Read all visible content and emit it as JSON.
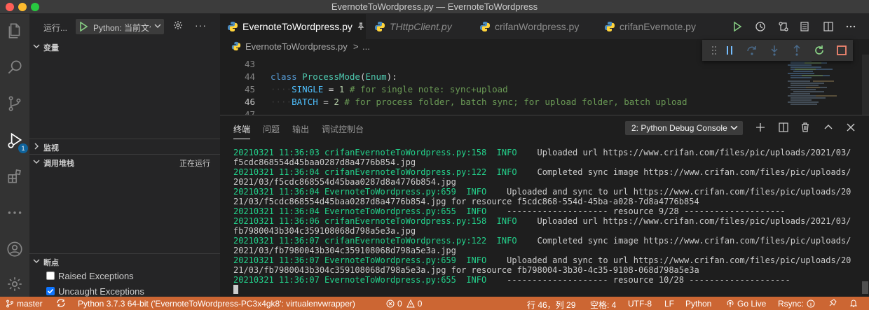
{
  "window": {
    "title": "EvernoteToWordpress.py — EvernoteToWordpress"
  },
  "colors": {
    "statusbar": "#cc6633",
    "accent": "#0e639c",
    "terminal_green": "#23d18b",
    "close": "#ff5f57",
    "minimize": "#febc2e",
    "maximize": "#28c840"
  },
  "activity": {
    "icons": [
      "files-icon",
      "search-icon",
      "source-control-icon",
      "run-debug-icon",
      "extensions-icon",
      "more-icon",
      "account-icon",
      "settings-gear-icon"
    ],
    "debug_badge": "1"
  },
  "sidebar": {
    "run_label": "运行...",
    "config": "Python: 当前文件",
    "sections": {
      "variables": "变量",
      "watch": "监视",
      "callstack": "调用堆栈",
      "callstack_status": "正在运行",
      "breakpoints": "断点"
    },
    "breakpoints": [
      {
        "label": "Raised Exceptions",
        "checked": false
      },
      {
        "label": "Uncaught Exceptions",
        "checked": true
      }
    ]
  },
  "tabs": [
    {
      "label": "EvernoteToWordpress.py",
      "active": true,
      "pinned": true
    },
    {
      "label": "THttpClient.py",
      "active": false,
      "italic": true
    },
    {
      "label": "crifanWordpress.py",
      "active": false
    },
    {
      "label": "crifanEvernote.py",
      "active": false
    }
  ],
  "breadcrumb": {
    "file": "EvernoteToWordpress.py",
    "sep": ">",
    "rest": "..."
  },
  "editor": {
    "lines": [
      {
        "num": "43",
        "current": false
      },
      {
        "num": "44",
        "current": false
      },
      {
        "num": "45",
        "current": false
      },
      {
        "num": "46",
        "current": true
      },
      {
        "num": "47",
        "current": false
      }
    ],
    "code": {
      "l44_kw": "class",
      "l44_name": "ProcessMode",
      "l44_paren_open": "(",
      "l44_base": "Enum",
      "l44_tail": "):",
      "l45_indent": "····",
      "l45_name": "SINGLE",
      "l45_eq": " = ",
      "l45_num": "1",
      "l45_comment": " # for single note: sync+upload",
      "l46_indent": "····",
      "l46_name": "BATCH",
      "l46_eq": " = ",
      "l46_num": "2",
      "l46_comment": " # for process folder, batch sync; for upload folder, batch upload"
    }
  },
  "panel": {
    "tabs": [
      "终端",
      "问题",
      "输出",
      "调试控制台"
    ],
    "active_tab": "终端",
    "console_select": "2: Python Debug Console",
    "terminal": [
      {
        "g": "20210321 11:36:03 crifanEvernoteToWordpress.py:158  INFO",
        "t": "    Uploaded url https://www.crifan.com/files/pic/uploads/2021/03/"
      },
      {
        "g": "",
        "t": "f5cdc868554d45baa0287d8a4776b854.jpg"
      },
      {
        "g": "20210321 11:36:04 crifanEvernoteToWordpress.py:122  INFO",
        "t": "    Completed sync image https://www.crifan.com/files/pic/uploads/"
      },
      {
        "g": "",
        "t": "2021/03/f5cdc868554d45baa0287d8a4776b854.jpg"
      },
      {
        "g": "20210321 11:36:04 EvernoteToWordpress.py:659  INFO",
        "t": "    Uploaded and sync to url https://www.crifan.com/files/pic/uploads/20"
      },
      {
        "g": "",
        "t": "21/03/f5cdc868554d45baa0287d8a4776b854.jpg for resource f5cdc868-554d-45ba-a028-7d8a4776b854"
      },
      {
        "g": "20210321 11:36:04 EvernoteToWordpress.py:655  INFO",
        "t": "    -------------------- resource 9/28 --------------------"
      },
      {
        "g": "20210321 11:36:06 crifanEvernoteToWordpress.py:158  INFO",
        "t": "    Uploaded url https://www.crifan.com/files/pic/uploads/2021/03/"
      },
      {
        "g": "",
        "t": "fb7980043b304c359108068d798a5e3a.jpg"
      },
      {
        "g": "20210321 11:36:07 crifanEvernoteToWordpress.py:122  INFO",
        "t": "    Completed sync image https://www.crifan.com/files/pic/uploads/"
      },
      {
        "g": "",
        "t": "2021/03/fb7980043b304c359108068d798a5e3a.jpg"
      },
      {
        "g": "20210321 11:36:07 EvernoteToWordpress.py:659  INFO",
        "t": "    Uploaded and sync to url https://www.crifan.com/files/pic/uploads/20"
      },
      {
        "g": "",
        "t": "21/03/fb7980043b304c359108068d798a5e3a.jpg for resource fb798004-3b30-4c35-9108-068d798a5e3a"
      },
      {
        "g": "20210321 11:36:07 EvernoteToWordpress.py:655  INFO",
        "t": "    -------------------- resource 10/28 --------------------"
      }
    ]
  },
  "statusbar": {
    "branch": "master",
    "interpreter": "Python 3.7.3 64-bit ('EvernoteToWordpress-PC3x4gk8': virtualenvwrapper)",
    "errors": "0",
    "warnings": "0",
    "position": "行 46，列 29",
    "spaces": "空格: 4",
    "encoding": "UTF-8",
    "eol": "LF",
    "language": "Python",
    "golive": "Go Live",
    "rsync": "Rsync:"
  }
}
